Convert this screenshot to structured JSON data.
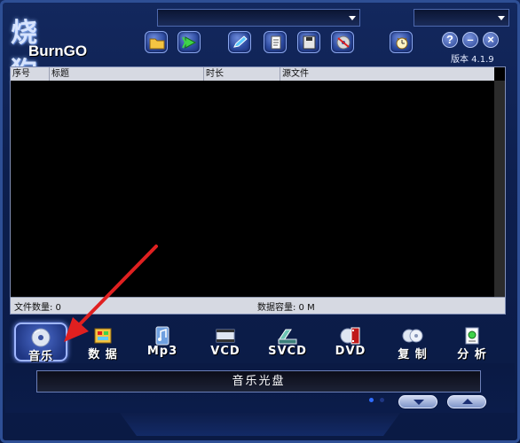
{
  "app": {
    "logo_cn": "烧 狗",
    "logo_en": "BurnGO",
    "version": "版本 4.1.9"
  },
  "toolbar": {
    "buttons": [
      {
        "name": "open-folder-icon"
      },
      {
        "name": "play-icon"
      },
      {
        "name": "edit-icon"
      },
      {
        "name": "document-icon"
      },
      {
        "name": "save-icon"
      },
      {
        "name": "burn-disc-icon"
      },
      {
        "name": "timer-icon"
      }
    ]
  },
  "window": {
    "help": "?",
    "minimize": "–",
    "close": "×"
  },
  "list": {
    "columns": [
      "序号",
      "标题",
      "时长",
      "源文件"
    ]
  },
  "status": {
    "file_count": "文件数量: 0",
    "data_capacity": "数据容量: 0 M"
  },
  "modes": [
    {
      "label": "音乐",
      "icon": "music-cd-icon",
      "active": true
    },
    {
      "label": "数 据",
      "icon": "data-disc-icon",
      "active": false
    },
    {
      "label": "Mp3",
      "icon": "mp3-icon",
      "active": false
    },
    {
      "label": "VCD",
      "icon": "vcd-icon",
      "active": false
    },
    {
      "label": "SVCD",
      "icon": "svcd-icon",
      "active": false
    },
    {
      "label": "DVD",
      "icon": "dvd-icon",
      "active": false
    },
    {
      "label": "复 制",
      "icon": "copy-disc-icon",
      "active": false
    },
    {
      "label": "分 析",
      "icon": "analyze-icon",
      "active": false
    }
  ],
  "disc_label": "音乐光盘",
  "colors": {
    "background": "#0d1f4e",
    "accent": "#2c4aa0",
    "header_gray": "#d6d9e2",
    "annotation_red": "#e02020"
  }
}
